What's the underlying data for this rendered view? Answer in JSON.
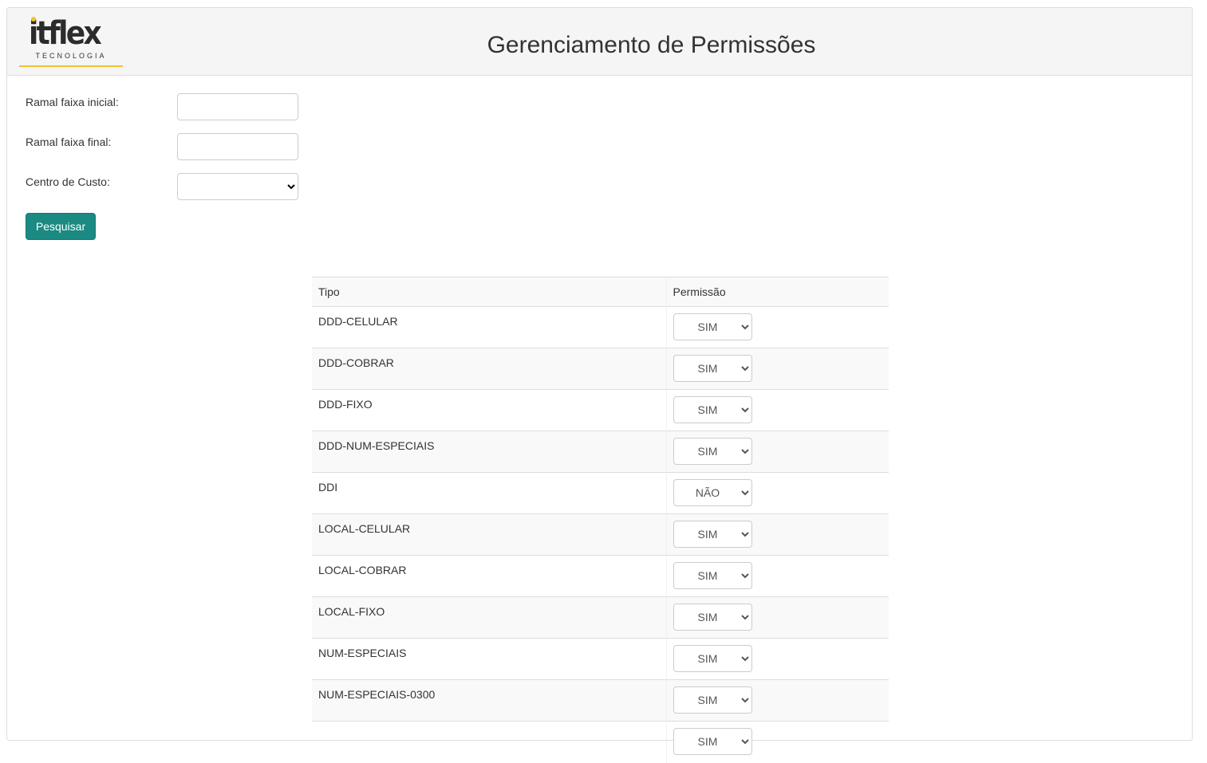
{
  "header": {
    "logo_text": "itflex",
    "logo_subtext": "TECNOLOGIA",
    "title": "Gerenciamento de Permissões"
  },
  "form": {
    "ramal_inicial_label": "Ramal faixa inicial:",
    "ramal_inicial_value": "",
    "ramal_final_label": "Ramal faixa final:",
    "ramal_final_value": "",
    "centro_custo_label": "Centro de Custo:",
    "centro_custo_value": "",
    "search_button": "Pesquisar"
  },
  "table": {
    "headers": [
      "Tipo",
      "Permissão"
    ],
    "rows": [
      {
        "tipo": "DDD-CELULAR",
        "permissao": "SIM"
      },
      {
        "tipo": "DDD-COBRAR",
        "permissao": "SIM"
      },
      {
        "tipo": "DDD-FIXO",
        "permissao": "SIM"
      },
      {
        "tipo": "DDD-NUM-ESPECIAIS",
        "permissao": "SIM"
      },
      {
        "tipo": "DDI",
        "permissao": "NÃO"
      },
      {
        "tipo": "LOCAL-CELULAR",
        "permissao": "SIM"
      },
      {
        "tipo": "LOCAL-COBRAR",
        "permissao": "SIM"
      },
      {
        "tipo": "LOCAL-FIXO",
        "permissao": "SIM"
      },
      {
        "tipo": "NUM-ESPECIAIS",
        "permissao": "SIM"
      },
      {
        "tipo": "NUM-ESPECIAIS-0300",
        "permissao": "SIM"
      },
      {
        "tipo": "",
        "permissao": "SIM"
      }
    ]
  },
  "colors": {
    "accent": "#1a8a82",
    "logo_accent": "#f2c230"
  }
}
